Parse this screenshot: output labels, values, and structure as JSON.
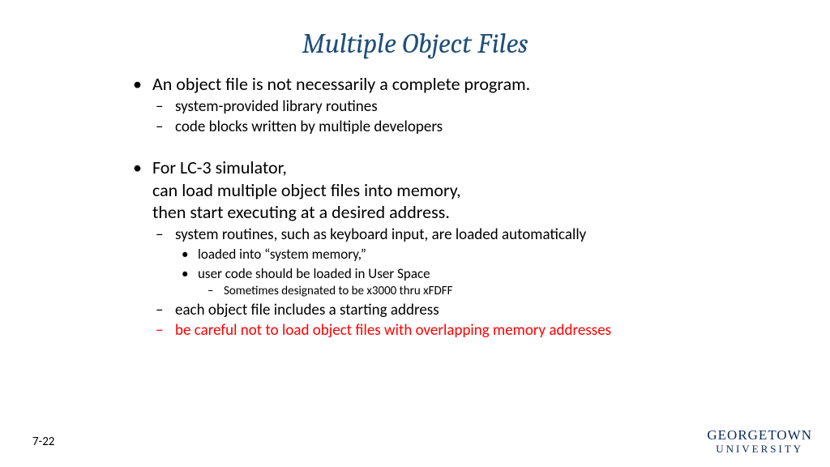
{
  "title": "Multiple Object Files",
  "bullets": {
    "b1_1": "An object file is not necessarily a complete program.",
    "b1_1_sub": {
      "a": "system-provided library routines",
      "b": "code blocks written by multiple developers"
    },
    "b1_2_line1": "For LC-3 simulator,",
    "b1_2_line2": "can load multiple object files into memory,",
    "b1_2_line3": "then start executing at a desired address.",
    "b1_2_sub": {
      "a": "system routines, such as keyboard input, are loaded automatically",
      "a_sub": {
        "i": "loaded into “system memory,”",
        "ii": "user code should be loaded in User Space",
        "ii_sub": "Sometimes designated to be x3000 thru xFDFF"
      },
      "b": "each object file includes a starting address",
      "c": "be careful not to load object files with overlapping memory addresses"
    }
  },
  "page_number": "7-22",
  "logo": {
    "line1": "GEORGETOWN",
    "line2": "UNIVERSITY"
  }
}
